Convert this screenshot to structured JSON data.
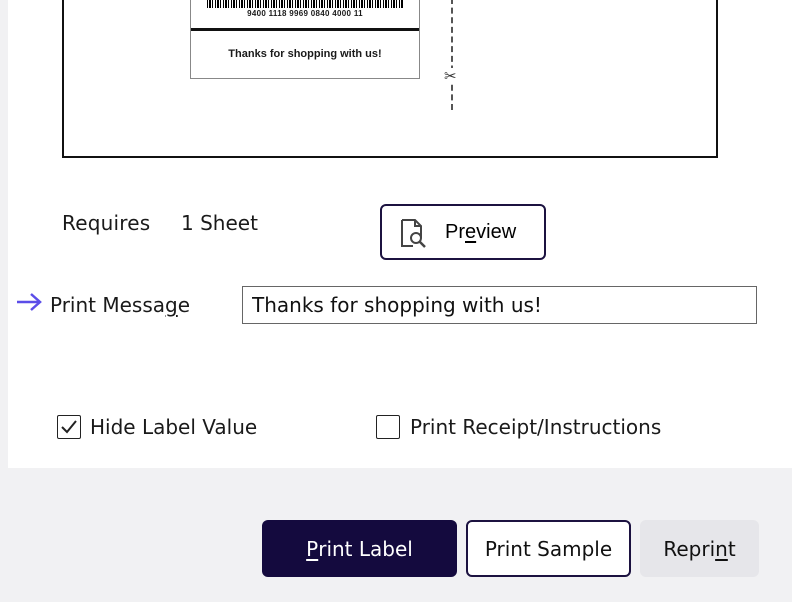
{
  "preview": {
    "barcode_number": "9400 1118 9969 0840 4000 11",
    "label_message": "Thanks for shopping with us!"
  },
  "requires": {
    "label": "Requires",
    "value": "1 Sheet"
  },
  "preview_button": {
    "prefix": "Pr",
    "accel": "e",
    "suffix": "view"
  },
  "print_message": {
    "label_prefix": "Print Messa",
    "label_accel": "g",
    "label_suffix": "e",
    "value": "Thanks for shopping with us!"
  },
  "options": {
    "hide_label_value": {
      "label": "Hide Label Value",
      "checked": true
    },
    "print_receipt": {
      "label": "Print Receipt/Instructions",
      "checked": false
    }
  },
  "buttons": {
    "print_label": {
      "accel": "P",
      "rest": "rint Label"
    },
    "print_sample": {
      "label": "Print Sample"
    },
    "reprint": {
      "prefix": "Repri",
      "accel": "n",
      "suffix": "t"
    }
  },
  "colors": {
    "primary": "#140a3e",
    "accent_arrow": "#5b4de8"
  }
}
